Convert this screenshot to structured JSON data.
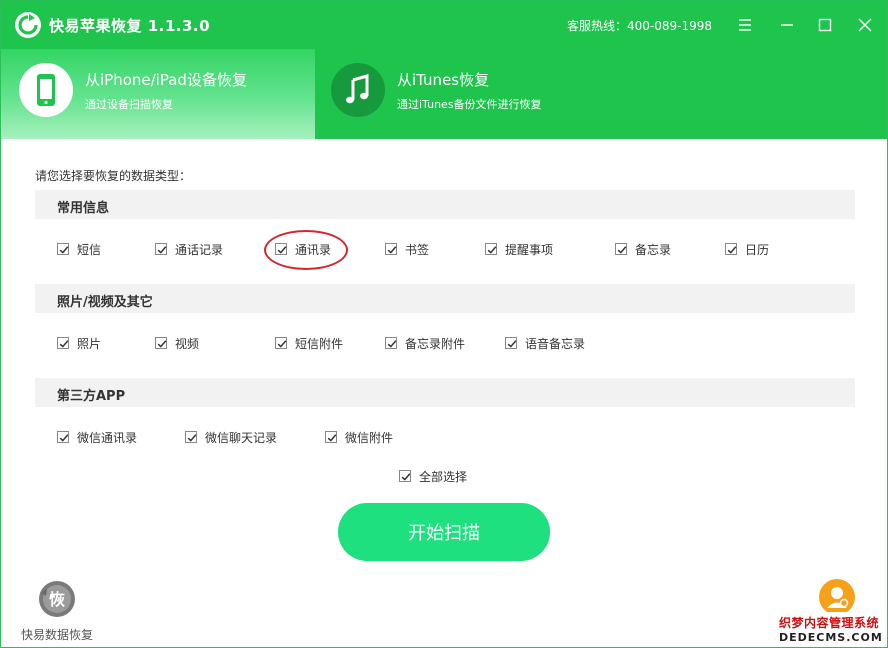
{
  "app": {
    "title": "快易苹果恢复 1.1.3.0",
    "hotline": "客服热线：400-089-1998",
    "accent_color": "#1ec44c",
    "window_controls": [
      "menu-icon",
      "minimize-icon",
      "maximize-icon",
      "close-icon"
    ]
  },
  "tabs": [
    {
      "title": "从iPhone/iPad设备恢复",
      "subtitle": "通过设备扫描恢复",
      "icon": "phone-icon",
      "selected": true
    },
    {
      "title": "从iTunes恢复",
      "subtitle": "通过iTunes备份文件进行恢复",
      "icon": "music-note-icon",
      "selected": false
    }
  ],
  "main": {
    "prompt": "请您选择要恢复的数据类型：",
    "sections": [
      {
        "title": "常用信息",
        "items": [
          "短信",
          "通话记录",
          "通讯录",
          "书签",
          "提醒事项",
          "备忘录",
          "日历"
        ]
      },
      {
        "title": "照片/视频及其它",
        "items": [
          "照片",
          "视频",
          "短信附件",
          "备忘录附件",
          "语音备忘录"
        ]
      },
      {
        "title": "第三方APP",
        "items": [
          "微信通讯录",
          "微信聊天记录",
          "微信附件"
        ]
      }
    ],
    "all_checked": true,
    "select_all": "全部选择",
    "scan_button": "开始扫描",
    "highlighted_item": "通讯录"
  },
  "footer": {
    "brand_logo_text": "恢",
    "brand_name": "快易数据恢复",
    "support_icon": "customer-service-icon",
    "watermark_line1": "织梦内容管理系统",
    "watermark_line2": "DEDECMS.COM"
  }
}
